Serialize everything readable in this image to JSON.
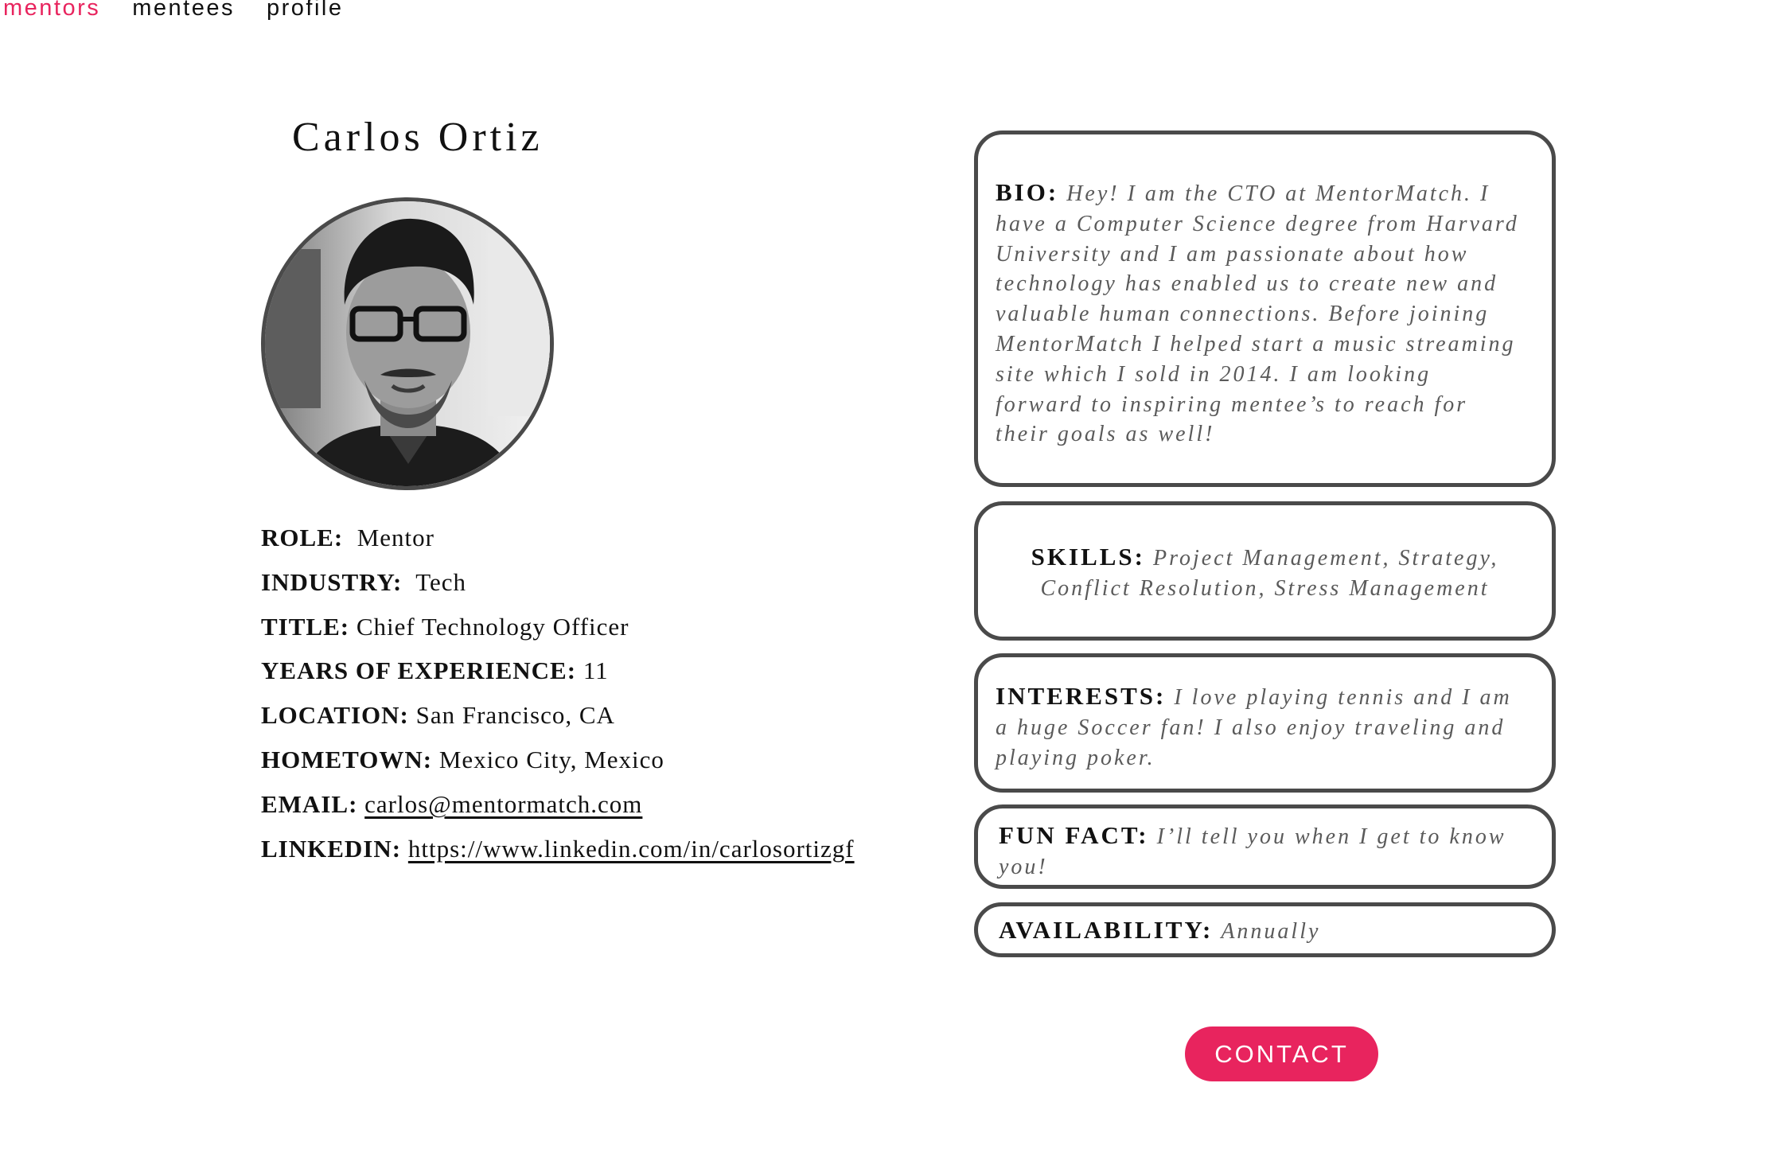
{
  "nav": {
    "items": [
      {
        "label": "mentors",
        "active": true
      },
      {
        "label": "mentees",
        "active": false
      },
      {
        "label": "profile",
        "active": false
      }
    ]
  },
  "profile": {
    "name": "Carlos Ortiz",
    "role_label": "ROLE:",
    "role": "Mentor",
    "industry_label": "INDUSTRY:",
    "industry": "Tech",
    "title_label": "TITLE:",
    "title": "Chief Technology Officer",
    "experience_label": "YEARS OF EXPERIENCE:",
    "experience": "11",
    "location_label": "LOCATION:",
    "location": "San Francisco, CA",
    "hometown_label": "HOMETOWN:",
    "hometown": "Mexico City, Mexico",
    "email_label": "EMAIL:",
    "email": "carlos@mentormatch.com",
    "linkedin_label": "LINKEDIN:",
    "linkedin": "https://www.linkedin.com/in/carlosortizgf"
  },
  "cards": {
    "bio_label": "BIO:",
    "bio": "Hey! I am the CTO at MentorMatch. I have a Computer Science degree from Harvard University and I am passionate about how technology has enabled us to create new and valuable human connections. Before joining MentorMatch I helped start a music streaming site which I sold in 2014. I am looking forward to inspiring mentee’s to reach for their goals as well!",
    "skills_label": "SKILLS:",
    "skills": "Project Management, Strategy, Conflict Resolution, Stress Management",
    "interests_label": "INTERESTS:",
    "interests": "I love playing tennis and I am a huge Soccer fan! I also enjoy traveling and playing poker.",
    "fun_fact_label": "FUN FACT:",
    "fun_fact": "I’ll tell you when I get to know you!",
    "availability_label": "AVAILABILITY:",
    "availability": "Annually"
  },
  "contact_label": "CONTACT",
  "colors": {
    "accent": "#e8245e",
    "border": "#4a4a4a",
    "muted_text": "#5a5a5a"
  }
}
